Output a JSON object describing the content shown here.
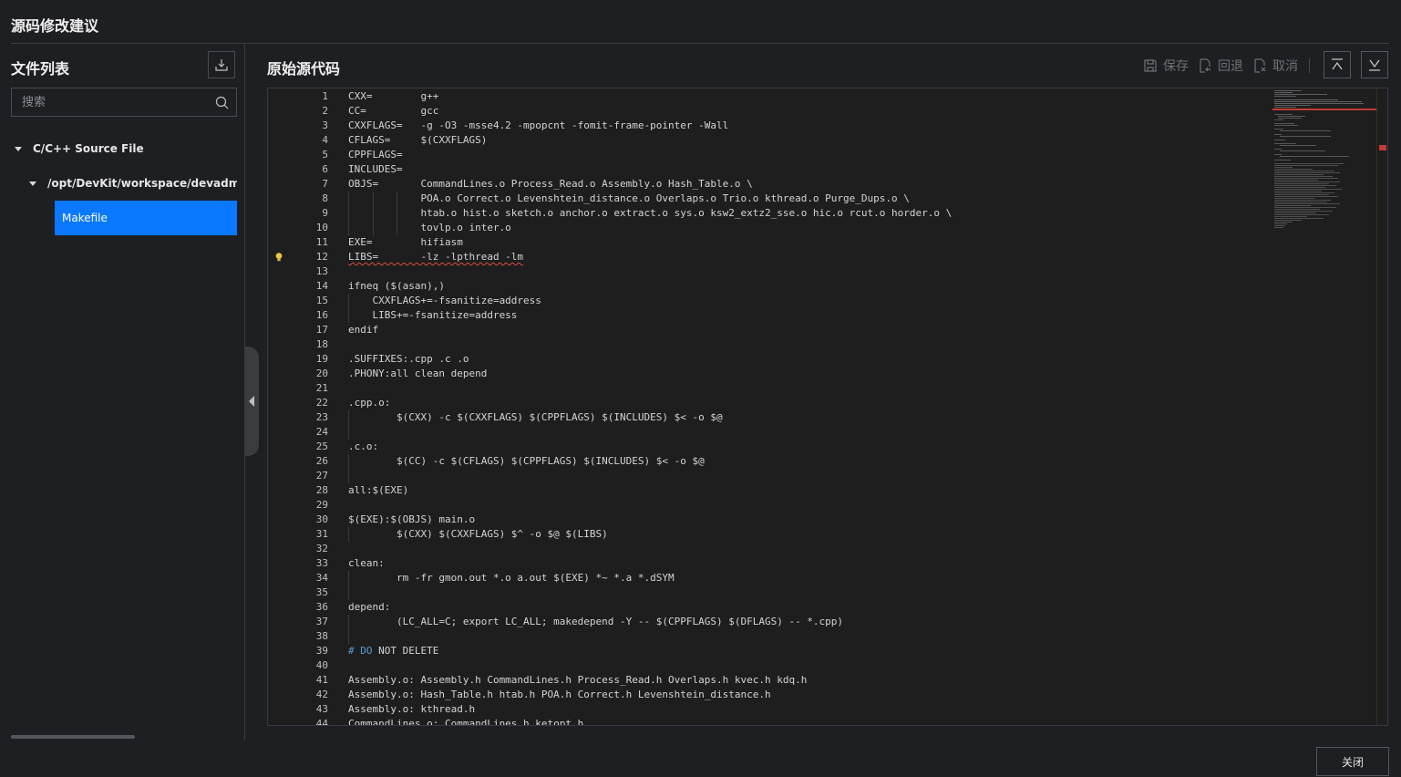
{
  "dialog": {
    "title": "源码修改建议",
    "close_label": "关闭"
  },
  "sidebar": {
    "title": "文件列表",
    "search_placeholder": "搜索",
    "tree": {
      "category": "C/C++ Source File",
      "folder": "/opt/DevKit/workspace/devadmin/af",
      "file": "Makefile"
    }
  },
  "main": {
    "title": "原始源代码",
    "toolbar": {
      "save": "保存",
      "revert": "回退",
      "cancel": "取消"
    }
  },
  "editor": {
    "lines": [
      "CXX=        g++",
      "CC=         gcc",
      "CXXFLAGS=   -g -O3 -msse4.2 -mpopcnt -fomit-frame-pointer -Wall",
      "CFLAGS=     $(CXXFLAGS)",
      "CPPFLAGS=",
      "INCLUDES=",
      "OBJS=       CommandLines.o Process_Read.o Assembly.o Hash_Table.o \\",
      "            POA.o Correct.o Levenshtein_distance.o Overlaps.o Trio.o kthread.o Purge_Dups.o \\",
      "            htab.o hist.o sketch.o anchor.o extract.o sys.o ksw2_extz2_sse.o hic.o rcut.o horder.o \\",
      "            tovlp.o inter.o",
      "EXE=        hifiasm",
      "LIBS=       -lz -lpthread -lm",
      "",
      "ifneq ($(asan),)",
      "    CXXFLAGS+=-fsanitize=address",
      "    LIBS+=-fsanitize=address",
      "endif",
      "",
      ".SUFFIXES:.cpp .c .o",
      ".PHONY:all clean depend",
      "",
      ".cpp.o:",
      "        $(CXX) -c $(CXXFLAGS) $(CPPFLAGS) $(INCLUDES) $< -o $@",
      "",
      ".c.o:",
      "        $(CC) -c $(CFLAGS) $(CPPFLAGS) $(INCLUDES) $< -o $@",
      "",
      "all:$(EXE)",
      "",
      "$(EXE):$(OBJS) main.o",
      "        $(CXX) $(CXXFLAGS) $^ -o $@ $(LIBS)",
      "",
      "clean:",
      "        rm -fr gmon.out *.o a.out $(EXE) *~ *.a *.dSYM",
      "",
      "depend:",
      "        (LC_ALL=C; export LC_ALL; makedepend -Y -- $(CPPFLAGS) $(DFLAGS) -- *.cpp)",
      "",
      "# DO NOT DELETE",
      "",
      "Assembly.o: Assembly.h CommandLines.h Process_Read.h Overlaps.h kvec.h kdq.h",
      "Assembly.o: Hash_Table.h htab.h POA.h Correct.h Levenshtein_distance.h",
      "Assembly.o: kthread.h",
      "CommandLines.o: CommandLines.h ketopt.h"
    ],
    "highlighted_line": 12,
    "accent": "#0a78ff",
    "error_color": "#e04848"
  }
}
